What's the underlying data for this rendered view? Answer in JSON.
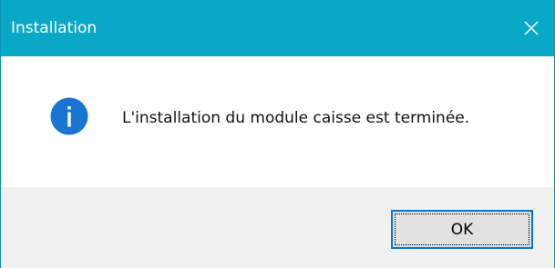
{
  "window": {
    "title": "Installation",
    "close_label": "Close"
  },
  "content": {
    "icon": "info-icon",
    "message": "L'installation du module caisse est terminée."
  },
  "footer": {
    "ok_label": "OK"
  },
  "colors": {
    "title_bar": "#0aa8c7",
    "info_icon": "#1876d2",
    "button_border": "#0078d7",
    "footer_bg": "#f0f0f0"
  }
}
